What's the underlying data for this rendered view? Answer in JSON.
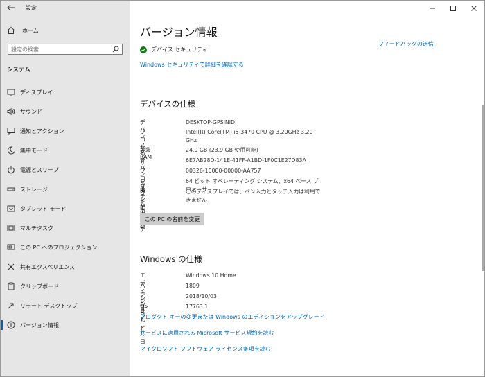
{
  "window": {
    "title": "設定"
  },
  "sidebar": {
    "home_label": "ホーム",
    "search_placeholder": "設定の検索",
    "section_label": "システム",
    "items": [
      {
        "label": "ディスプレイ",
        "icon": "monitor-icon"
      },
      {
        "label": "サウンド",
        "icon": "speaker-icon"
      },
      {
        "label": "通知とアクション",
        "icon": "notification-icon"
      },
      {
        "label": "集中モード",
        "icon": "moon-icon"
      },
      {
        "label": "電源とスリープ",
        "icon": "power-icon"
      },
      {
        "label": "ストレージ",
        "icon": "storage-icon"
      },
      {
        "label": "タブレット モード",
        "icon": "tablet-icon"
      },
      {
        "label": "マルチタスク",
        "icon": "multitask-icon"
      },
      {
        "label": "この PC へのプロジェクション",
        "icon": "projection-icon"
      },
      {
        "label": "共有エクスペリエンス",
        "icon": "shared-icon"
      },
      {
        "label": "クリップボード",
        "icon": "clipboard-icon"
      },
      {
        "label": "リモート デスクトップ",
        "icon": "remote-icon"
      },
      {
        "label": "バージョン情報",
        "icon": "info-icon",
        "active": true
      }
    ]
  },
  "main": {
    "title": "バージョン情報",
    "feedback_link": "フィードバックの送信",
    "security_status": "デバイス セキュリティ",
    "security_link": "Windows セキュリティで詳細を確認する",
    "device_specs_heading": "デバイスの仕様",
    "device_specs": [
      {
        "key": "デバイス名",
        "value": "DESKTOP-GPSINID"
      },
      {
        "key": "プロセッサ",
        "value": "Intel(R) Core(TM) i5-3470 CPU @ 3.20GHz   3.20 GHz"
      },
      {
        "key": "実装 RAM",
        "value": "24.0 GB (23.9 GB 使用可能)"
      },
      {
        "key": "デバイス ID",
        "value": "6E7AB28D-141E-41FF-A1BD-1F0C1E27D83A"
      },
      {
        "key": "プロダクト ID",
        "value": "00326-10000-00000-AA757"
      },
      {
        "key": "システムの種類",
        "value": "64 ビット オペレーティング システム、x64 ベース プロセッサ"
      },
      {
        "key": "ペンとタッチ",
        "value": "このディスプレイでは、ペン入力とタッチ入力は利用できません"
      }
    ],
    "rename_button": "この PC の名前を変更",
    "windows_specs_heading": "Windows の仕様",
    "windows_specs": [
      {
        "key": "エディション",
        "value": "Windows 10 Home"
      },
      {
        "key": "バージョン",
        "value": "1809"
      },
      {
        "key": "インストール日",
        "value": "2018/10/03"
      },
      {
        "key": "OS ビルド",
        "value": "17763.1"
      }
    ],
    "links": [
      "プロダクト キーの変更または Windows のエディションをアップグレード",
      "サービスに適用される Microsoft サービス規約を読む",
      "マイクロソフト ソフトウェア ライセンス条項を読む"
    ]
  },
  "colors": {
    "accent": "#0063b1",
    "sidebar_bg": "#e6e6e6",
    "ok_green": "#107c10",
    "button_bg": "#cccccc"
  }
}
